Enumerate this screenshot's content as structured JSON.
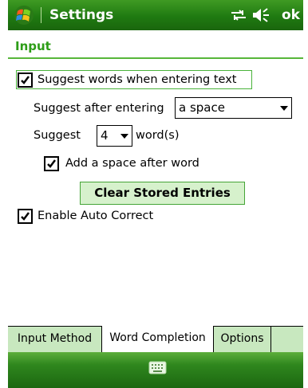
{
  "window": {
    "title": "Settings",
    "ok_label": "ok",
    "status_icons": [
      "start-menu-icon",
      "connectivity-icon",
      "speaker-icon"
    ]
  },
  "page": {
    "title": "Input"
  },
  "options": {
    "suggest_words": {
      "label": "Suggest words when entering text",
      "checked": true
    },
    "suggest_after": {
      "label": "Suggest after entering",
      "value": "a space"
    },
    "suggest_count": {
      "prefix": "Suggest",
      "value": "4",
      "suffix": "word(s)"
    },
    "add_space": {
      "label": "Add a space after word",
      "checked": true
    },
    "clear_button_label": "Clear Stored Entries",
    "auto_correct": {
      "label": "Enable Auto Correct",
      "checked": true
    }
  },
  "tabs": [
    {
      "label": "Input Method",
      "active": false
    },
    {
      "label": "Word Completion",
      "active": true
    },
    {
      "label": "Options",
      "active": false
    }
  ],
  "command_bar": {
    "icon": "keyboard-icon"
  },
  "colors": {
    "accent": "#2d9d17",
    "titlebar": "#1f7a11",
    "tab_inactive": "#c8e8bf",
    "focus": "#49b33a"
  }
}
